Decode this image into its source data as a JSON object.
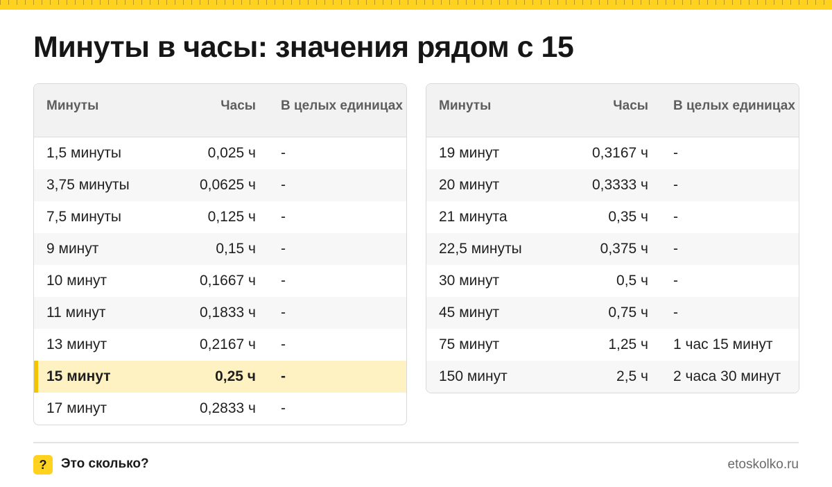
{
  "title": "Минуты в часы: значения рядом с 15",
  "colors": {
    "accent": "#ffd21f",
    "highlight_row": "#fff2c2",
    "highlight_bar": "#f5c400"
  },
  "headers": {
    "minutes": "Минуты",
    "hours": "Часы",
    "whole_units": "В целых единицах"
  },
  "left_table": [
    {
      "minutes": "1,5 минуты",
      "hours": "0,025 ч",
      "whole": "-"
    },
    {
      "minutes": "3,75 минуты",
      "hours": "0,0625 ч",
      "whole": "-"
    },
    {
      "minutes": "7,5 минуты",
      "hours": "0,125 ч",
      "whole": "-"
    },
    {
      "minutes": "9 минут",
      "hours": "0,15 ч",
      "whole": "-"
    },
    {
      "minutes": "10 минут",
      "hours": "0,1667 ч",
      "whole": "-"
    },
    {
      "minutes": "11 минут",
      "hours": "0,1833 ч",
      "whole": "-"
    },
    {
      "minutes": "13 минут",
      "hours": "0,2167 ч",
      "whole": "-"
    },
    {
      "minutes": "15 минут",
      "hours": "0,25 ч",
      "whole": "-"
    },
    {
      "minutes": "17 минут",
      "hours": "0,2833 ч",
      "whole": "-"
    }
  ],
  "right_table": [
    {
      "minutes": "19 минут",
      "hours": "0,3167 ч",
      "whole": "-"
    },
    {
      "minutes": "20 минут",
      "hours": "0,3333 ч",
      "whole": "-"
    },
    {
      "minutes": "21 минута",
      "hours": "0,35 ч",
      "whole": "-"
    },
    {
      "minutes": "22,5 минуты",
      "hours": "0,375 ч",
      "whole": "-"
    },
    {
      "minutes": "30 минут",
      "hours": "0,5 ч",
      "whole": "-"
    },
    {
      "minutes": "45 минут",
      "hours": "0,75 ч",
      "whole": "-"
    },
    {
      "minutes": "75 минут",
      "hours": "1,25 ч",
      "whole": "1 час 15 минут"
    },
    {
      "minutes": "150 минут",
      "hours": "2,5 ч",
      "whole": "2 часа 30 минут"
    }
  ],
  "footer": {
    "badge": "?",
    "brand": "Это сколько?",
    "site": "etoskolko.ru",
    "badge_icon": "question-mark-icon"
  }
}
